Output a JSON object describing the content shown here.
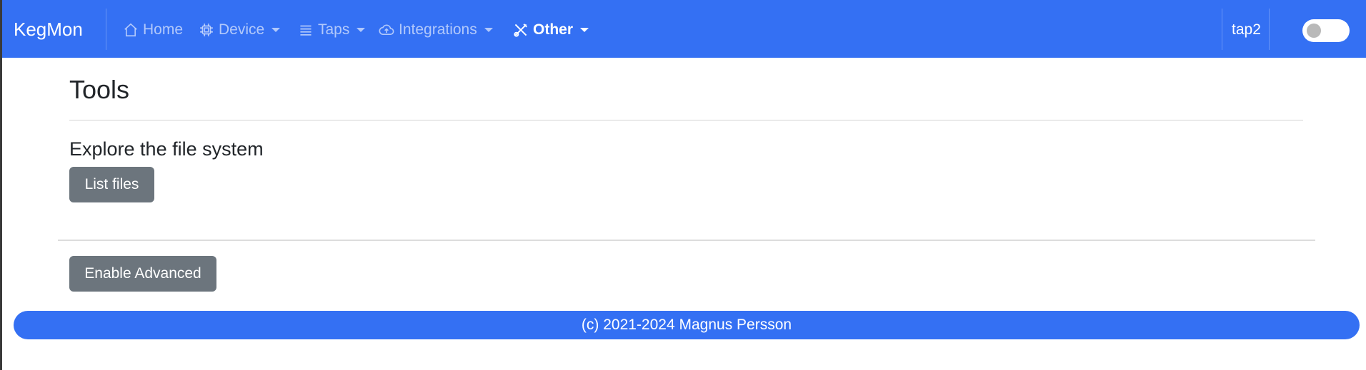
{
  "navbar": {
    "brand": "KegMon",
    "items": [
      {
        "label": "Home",
        "icon": "house-icon",
        "dropdown": false,
        "active": false
      },
      {
        "label": "Device",
        "icon": "cpu-icon",
        "dropdown": true,
        "active": false
      },
      {
        "label": "Taps",
        "icon": "list-icon",
        "dropdown": true,
        "active": false
      },
      {
        "label": "Integrations",
        "icon": "cloud-upload-icon",
        "dropdown": true,
        "active": false
      },
      {
        "label": "Other",
        "icon": "tools-icon",
        "dropdown": true,
        "active": true
      }
    ],
    "device_name": "tap2",
    "toggle_on": false
  },
  "page": {
    "title": "Tools",
    "section_heading": "Explore the file system",
    "list_files_label": "List files",
    "enable_advanced_label": "Enable Advanced"
  },
  "footer": {
    "text": "(c) 2021-2024 Magnus Persson"
  },
  "colors": {
    "primary": "#3470F3",
    "secondary_button": "#6c757d"
  }
}
